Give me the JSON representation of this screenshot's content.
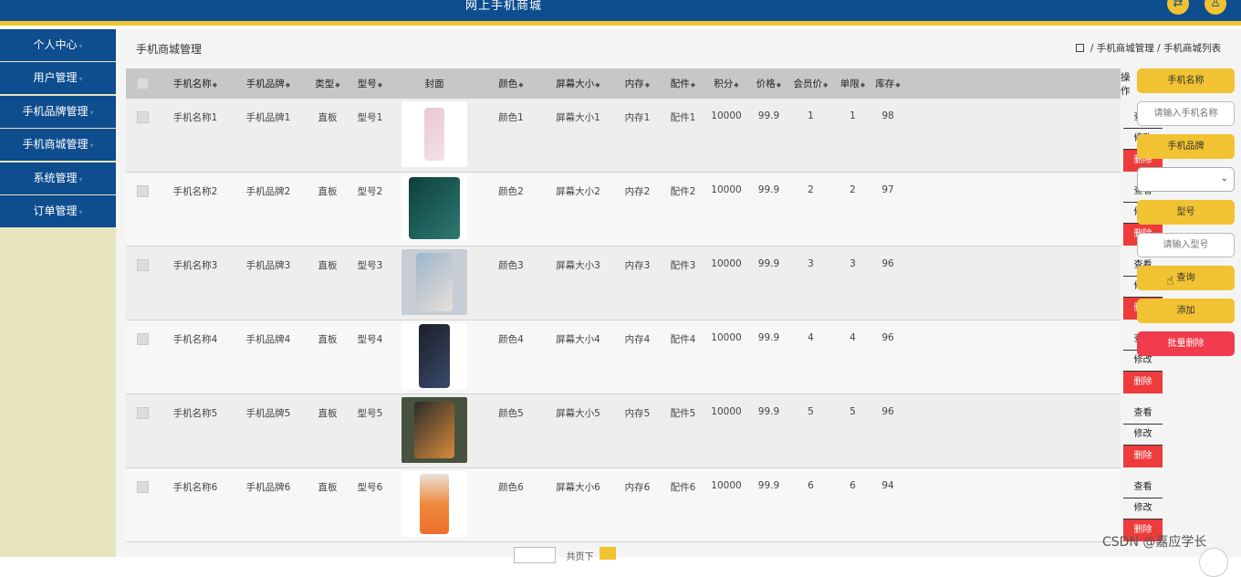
{
  "app_title": "网上手机商城",
  "header_icons": [
    "shuffle-icon",
    "user-icon"
  ],
  "sidebar": {
    "items": [
      "个人中心",
      "用户管理",
      "手机品牌管理",
      "手机商城管理",
      "系统管理",
      "订单管理"
    ]
  },
  "page": {
    "title": "手机商城管理",
    "breadcrumb": {
      "level1": "手机商城管理",
      "level2": "手机商城列表",
      "sep": "/"
    }
  },
  "table": {
    "columns": [
      "手机名称",
      "手机品牌",
      "类型",
      "型号",
      "封面",
      "颜色",
      "屏幕大小",
      "内存",
      "配件",
      "积分",
      "价格",
      "会员价",
      "单限",
      "库存",
      "操作"
    ],
    "rows": [
      {
        "name": "手机名称1",
        "brand": "手机品牌1",
        "type": "直板",
        "model": "型号1",
        "color": "颜色1",
        "screen": "屏幕大小1",
        "memory": "内存1",
        "accessory": "配件1",
        "points": "10000",
        "price": "99.9",
        "member_price": "1",
        "limit": "1",
        "stock": "98",
        "cover": "pink-phone"
      },
      {
        "name": "手机名称2",
        "brand": "手机品牌2",
        "type": "直板",
        "model": "型号2",
        "color": "颜色2",
        "screen": "屏幕大小2",
        "memory": "内存2",
        "accessory": "配件2",
        "points": "10000",
        "price": "99.9",
        "member_price": "2",
        "limit": "2",
        "stock": "97",
        "cover": "green-phone"
      },
      {
        "name": "手机名称3",
        "brand": "手机品牌3",
        "type": "直板",
        "model": "型号3",
        "color": "颜色3",
        "screen": "屏幕大小3",
        "memory": "内存3",
        "accessory": "配件3",
        "points": "10000",
        "price": "99.9",
        "member_price": "3",
        "limit": "3",
        "stock": "96",
        "cover": "hand-phone"
      },
      {
        "name": "手机名称4",
        "brand": "手机品牌4",
        "type": "直板",
        "model": "型号4",
        "color": "颜色4",
        "screen": "屏幕大小4",
        "memory": "内存4",
        "accessory": "配件4",
        "points": "10000",
        "price": "99.9",
        "member_price": "4",
        "limit": "4",
        "stock": "96",
        "cover": "dark-phone"
      },
      {
        "name": "手机名称5",
        "brand": "手机品牌5",
        "type": "直板",
        "model": "型号5",
        "color": "颜色5",
        "screen": "屏幕大小5",
        "memory": "内存5",
        "accessory": "配件5",
        "points": "10000",
        "price": "99.9",
        "member_price": "5",
        "limit": "5",
        "stock": "96",
        "cover": "box-phone"
      },
      {
        "name": "手机名称6",
        "brand": "手机品牌6",
        "type": "直板",
        "model": "型号6",
        "color": "颜色6",
        "screen": "屏幕大小6",
        "memory": "内存6",
        "accessory": "配件6",
        "points": "10000",
        "price": "99.9",
        "member_price": "6",
        "limit": "6",
        "stock": "94",
        "cover": "orange-phone"
      }
    ],
    "actions": {
      "view": "查看",
      "edit": "修改",
      "delete": "删除"
    }
  },
  "search_panel": {
    "name_label": "手机名称",
    "name_placeholder": "请输入手机名称",
    "brand_label": "手机品牌",
    "model_label": "型号",
    "model_placeholder": "请输入型号",
    "query_button": "查询",
    "add_button": "添加",
    "batch_delete_button": "批量删除"
  },
  "pager": {
    "text": "共页下"
  },
  "watermark": "CSDN @嘉应学长",
  "colors": {
    "header": "#0e4d8e",
    "accent": "#f1c231",
    "danger": "#ee3b3b",
    "sidebar_bg": "#e6e4bd"
  }
}
